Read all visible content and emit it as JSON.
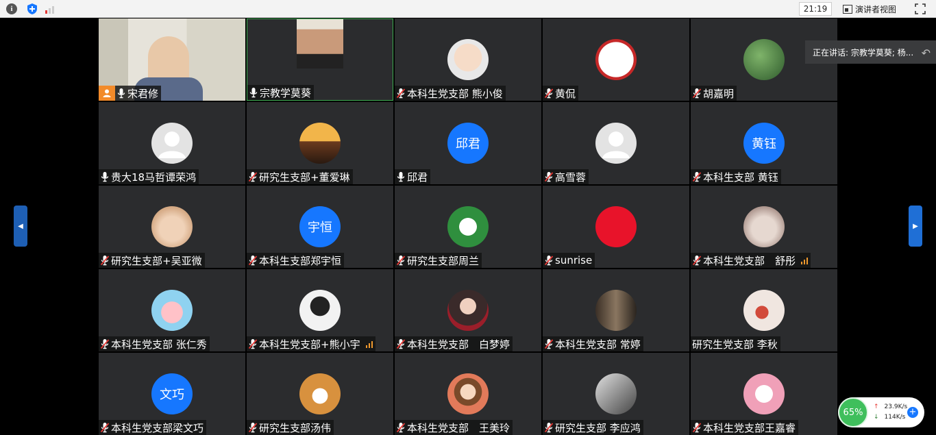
{
  "toolbar": {
    "clock": "21:19",
    "speaker_view_label": "演讲者视图"
  },
  "speaking_now": "正在讲话: 宗教学莫葵; 杨...",
  "network": {
    "quality": "65%",
    "upload": "23.9K/s",
    "download": "114K/s"
  },
  "participants": [
    {
      "name": "宋君修",
      "mic": "on",
      "video": true,
      "host": true
    },
    {
      "name": "宗教学莫葵",
      "mic": "on",
      "video": true,
      "active": true
    },
    {
      "name": "本科生党支部 熊小俊",
      "mic": "muted",
      "avatar": "baby"
    },
    {
      "name": "黄侃",
      "mic": "muted",
      "avatar": "logo"
    },
    {
      "name": "胡嘉明",
      "mic": "muted",
      "avatar": "tree"
    },
    {
      "name": "贵大18马哲谭荣鸿",
      "mic": "on",
      "avatar": "default"
    },
    {
      "name": "研究生支部+董爱琳",
      "mic": "muted",
      "avatar": "sunset"
    },
    {
      "name": "邱君",
      "mic": "on",
      "avatar_text": "邱君"
    },
    {
      "name": "高雪蓉",
      "mic": "muted",
      "avatar": "default"
    },
    {
      "name": "本科生支部 黄钰",
      "mic": "muted",
      "avatar_text": "黄钰"
    },
    {
      "name": "研究生支部+吴亚微",
      "mic": "muted",
      "avatar": "dog"
    },
    {
      "name": "本科生支部郑宇恒",
      "mic": "muted",
      "avatar_text": "宇恒"
    },
    {
      "name": "研究生支部周兰",
      "mic": "muted",
      "avatar": "cat"
    },
    {
      "name": "sunrise",
      "mic": "muted",
      "avatar": "red"
    },
    {
      "name": "本科生党支部　舒彤",
      "mic": "muted",
      "avatar": "kitten",
      "bars": true
    },
    {
      "name": "本科生党支部 张仁秀",
      "mic": "muted",
      "avatar": "cartoon"
    },
    {
      "name": "本科生党支部+熊小宇",
      "mic": "muted",
      "avatar": "portrait",
      "bars": true
    },
    {
      "name": "本科生党支部　白梦婷",
      "mic": "muted",
      "avatar": "girl"
    },
    {
      "name": "本科生党支部 常婷",
      "mic": "muted",
      "avatar": "photo"
    },
    {
      "name": "研究生党支部 李秋",
      "mic": "none",
      "avatar": "flower"
    },
    {
      "name": "本科生党支部梁文巧",
      "mic": "muted",
      "avatar_text": "文巧"
    },
    {
      "name": "研究生支部汤伟",
      "mic": "muted",
      "avatar": "shiba"
    },
    {
      "name": "本科生党支部　王美玲",
      "mic": "muted",
      "avatar": "doll"
    },
    {
      "name": "研究生支部 李应鸿",
      "mic": "muted",
      "avatar": "bw"
    },
    {
      "name": "本科生党支部王嘉睿",
      "mic": "muted",
      "avatar": "pinkcat"
    }
  ]
}
